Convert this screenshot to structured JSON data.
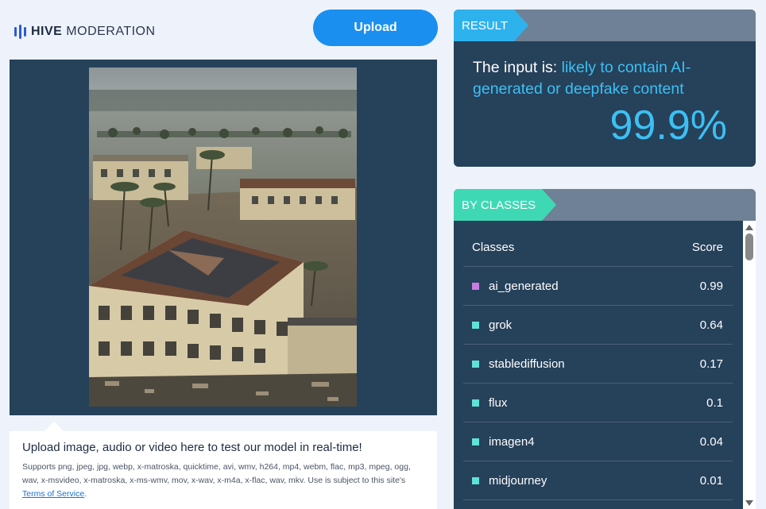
{
  "brand": {
    "bold": "HIVE",
    "light": "MODERATION"
  },
  "toolbar": {
    "upload_label": "Upload"
  },
  "upload_info": {
    "heading": "Upload image, audio or video here to test our model in real-time!",
    "supports_text": "Supports png, jpeg, jpg, webp, x-matroska, quicktime, avi, wmv, h264, mp4, webm, flac, mp3, mpeg, ogg, wav, x-msvideo, x-matroska, x-ms-wmv, mov, x-wav, x-m4a, x-flac, wav, mkv. Use is subject to this site's ",
    "terms_link": "Terms of Service",
    "terms_suffix": "."
  },
  "result": {
    "tag": "RESULT",
    "prefix": "The input is: ",
    "verdict": "likely to contain AI-generated or deepfake content",
    "score": "99.9%"
  },
  "classes": {
    "tag": "BY CLASSES",
    "header_class": "Classes",
    "header_score": "Score",
    "rows": [
      {
        "name": "ai_generated",
        "score": "0.99",
        "color": "#c77de0"
      },
      {
        "name": "grok",
        "score": "0.64",
        "color": "#5fe3d6"
      },
      {
        "name": "stablediffusion",
        "score": "0.17",
        "color": "#5fe3d6"
      },
      {
        "name": "flux",
        "score": "0.1",
        "color": "#5fe3d6"
      },
      {
        "name": "imagen4",
        "score": "0.04",
        "color": "#5fe3d6"
      },
      {
        "name": "midjourney",
        "score": "0.01",
        "color": "#5fe3d6"
      }
    ]
  },
  "colors": {
    "accent": "#1a8ff0",
    "highlight": "#3cc0f4",
    "panel": "#26415a",
    "result_tag": "#2eb2ee",
    "classes_tag": "#3fd8b5"
  }
}
